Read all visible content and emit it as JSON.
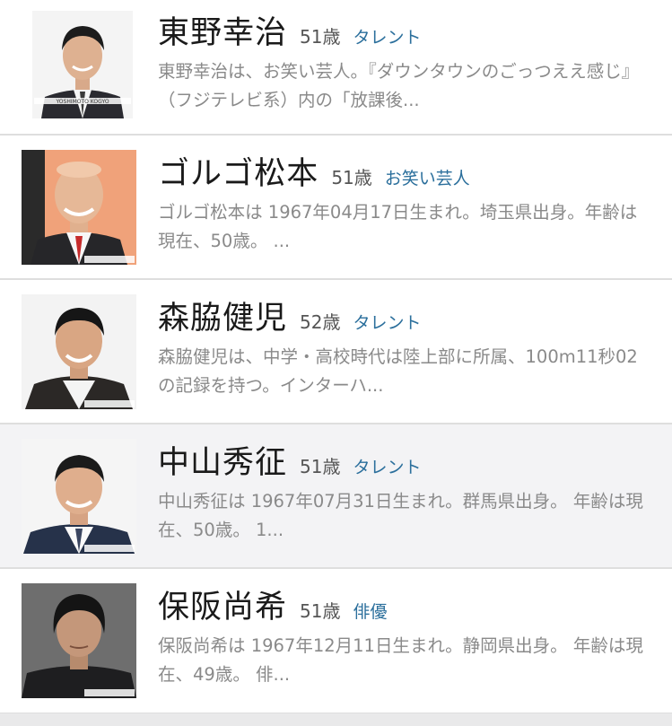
{
  "results": [
    {
      "name": "東野幸治",
      "age": "51歳",
      "category": "タレント",
      "description": "東野幸治は、お笑い芸人。『ダウンタウンのごっつええ感じ』（フジテレビ系）内の「放課後...",
      "photo_watermark": "タレントデータバンク"
    },
    {
      "name": "ゴルゴ松本",
      "age": "51歳",
      "category": "お笑い芸人",
      "description": "ゴルゴ松本は 1967年04月17日生まれ。埼玉県出身。年齢は現在、50歳。 ...",
      "photo_watermark": "タレントデータバンク"
    },
    {
      "name": "森脇健児",
      "age": "52歳",
      "category": "タレント",
      "description": "森脇健児は、中学・高校時代は陸上部に所属、100m11秒02の記録を持つ。インターハ...",
      "photo_watermark": "タレントデータバンク"
    },
    {
      "name": "中山秀征",
      "age": "51歳",
      "category": "タレント",
      "description": "中山秀征は 1967年07月31日生まれ。群馬県出身。 年齢は現在、50歳。 1...",
      "photo_watermark": "タレントデータバンク"
    },
    {
      "name": "保阪尚希",
      "age": "51歳",
      "category": "俳優",
      "description": "保阪尚希は 1967年12月11日生まれ。静岡県出身。 年齢は現在、49歳。 俳...",
      "photo_watermark": "タレントデータバンク"
    }
  ],
  "colors": {
    "category": "#2b6f9c",
    "name": "#1a1a1a",
    "description": "#8a8a8a",
    "divider": "#dedede"
  }
}
